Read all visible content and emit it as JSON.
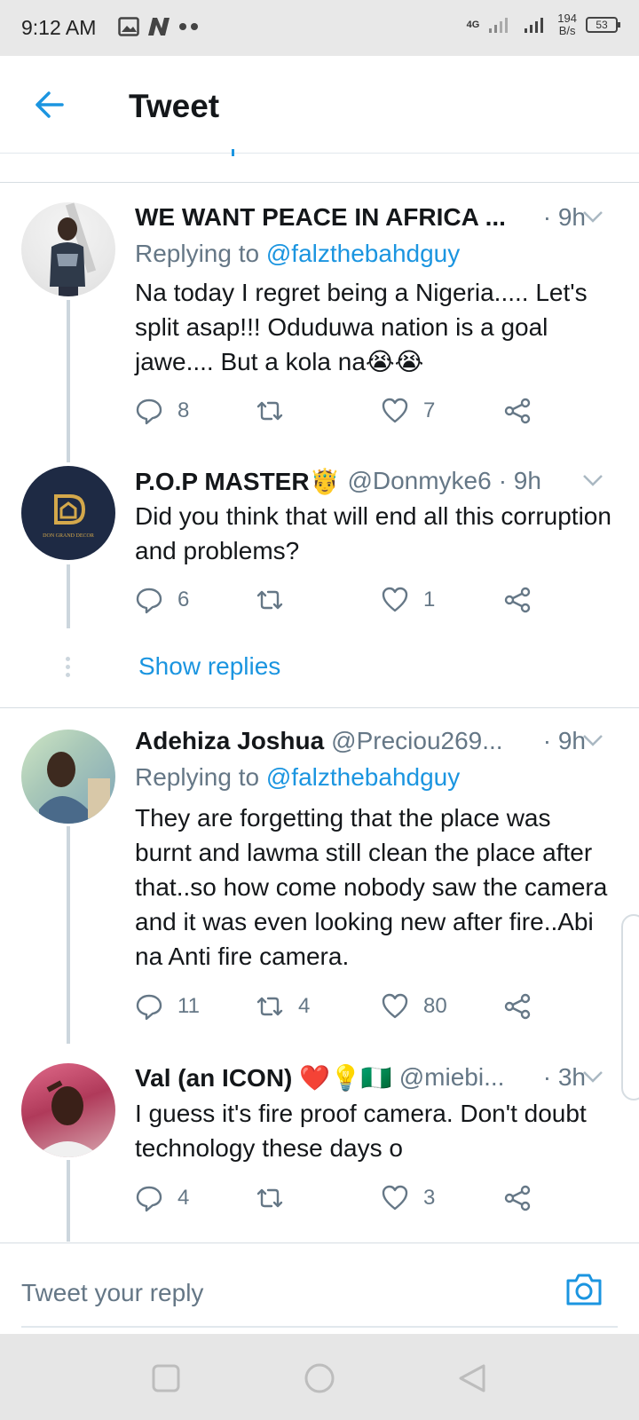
{
  "status_bar": {
    "time": "9:12 AM",
    "network": "4G",
    "speed_value": "194",
    "speed_unit": "B/s",
    "battery": "53",
    "icons": [
      "image-icon",
      "n-app-icon",
      "more-dots-icon",
      "signal-icon",
      "battery-icon"
    ]
  },
  "header": {
    "title": "Tweet",
    "back_icon": "back-arrow-icon"
  },
  "tweets": [
    {
      "name": "WE WANT PEACE IN AFRICA ...",
      "handle": "",
      "time": "· 9h",
      "reply_prefix": "Replying to ",
      "reply_mention": "@falzthebahdguy",
      "text": "Na today I regret being a Nigeria..... Let's split asap!!! Oduduwa nation is a goal jawe.... But a kola na😭😭",
      "replies": "8",
      "retweets": "",
      "likes": "7"
    },
    {
      "name": "P.O.P MASTER🤴",
      "handle": "@Donmyke6",
      "time": "· 9h",
      "text": "Did you think that will end all this corruption and problems?",
      "replies": "6",
      "retweets": "",
      "likes": "1",
      "avatar_text": "DON GRAND DECOR"
    },
    {
      "name": "Adehiza Joshua",
      "handle": "@Preciou269...",
      "time": "· 9h",
      "reply_prefix": "Replying to ",
      "reply_mention": "@falzthebahdguy",
      "text": "They are forgetting that the place was burnt and lawma still clean the place after that..so how come nobody saw the camera and it was even looking new after fire..Abi na Anti fire camera.",
      "replies": "11",
      "retweets": "4",
      "likes": "80"
    },
    {
      "name": "Val (an ICON) ❤️💡🇳🇬",
      "handle": "@miebi...",
      "time": "· 3h",
      "text": "I guess it's fire proof camera. Don't doubt technology these days o",
      "replies": "4",
      "retweets": "",
      "likes": "3"
    }
  ],
  "show_replies": "Show replies",
  "reply_box": {
    "placeholder": "Tweet your reply",
    "camera_icon": "camera-icon"
  },
  "colors": {
    "accent": "#1b95e0",
    "muted": "#657786",
    "text": "#14171a",
    "divider": "#d6dde2"
  }
}
